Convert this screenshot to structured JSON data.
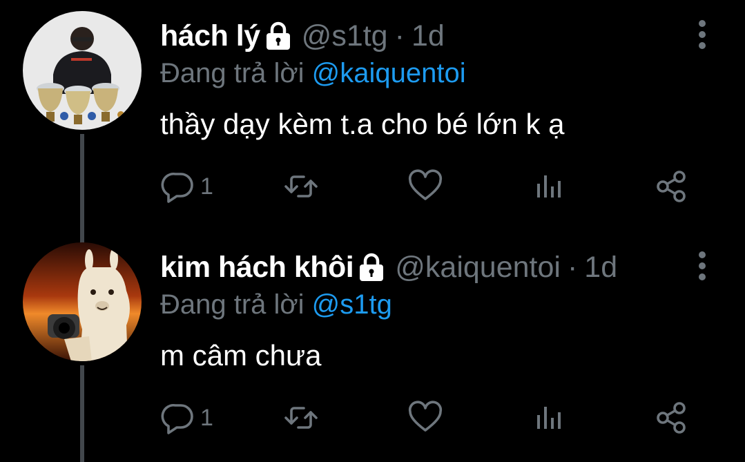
{
  "tweets": [
    {
      "display_name": "hách lý",
      "handle": "@s1tg",
      "separator": "·",
      "time": "1d",
      "reply_prefix": "Đang trả lời",
      "reply_to": "@kaiquentoi",
      "text": "thầy dạy kèm t.a cho bé lớn k ạ",
      "reply_count": "1"
    },
    {
      "display_name": "kim hách khôi",
      "handle": "@kaiquentoi",
      "separator": "·",
      "time": "1d",
      "reply_prefix": "Đang trả lời",
      "reply_to": "@s1tg",
      "text": "m câm chưa",
      "reply_count": "1"
    }
  ],
  "colors": {
    "background": "#000000",
    "secondary_text": "#6e767d",
    "mention": "#1d9bf0",
    "icon": "#6e767d",
    "thread_line": "#42474c"
  },
  "icons": [
    "lock-icon",
    "more-vertical-icon",
    "reply-icon",
    "retweet-icon",
    "heart-icon",
    "analytics-icon",
    "share-icon"
  ]
}
